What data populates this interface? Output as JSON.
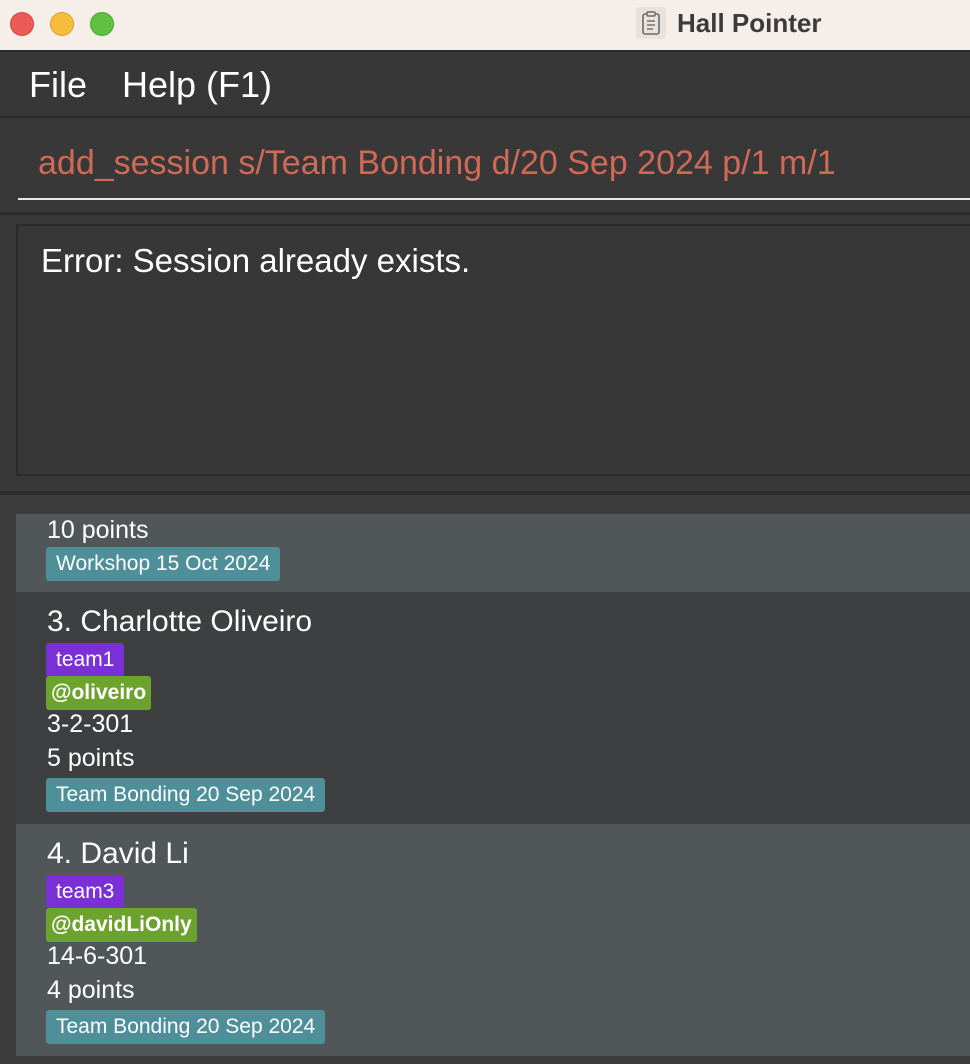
{
  "window": {
    "title": "Hall Pointer"
  },
  "menu": {
    "file": "File",
    "help": "Help (F1)"
  },
  "command": {
    "value": "add_session s/Team Bonding d/20 Sep 2024 p/1 m/1"
  },
  "result": {
    "message": "Error: Session already exists."
  },
  "members": [
    {
      "points": "10 points",
      "sessions": [
        "Workshop 15 Oct 2024"
      ]
    },
    {
      "name": "3. Charlotte Oliveiro",
      "tag": "team1",
      "telegram": "@oliveiro",
      "room": "3-2-301",
      "points": "5 points",
      "sessions": [
        "Team Bonding 20 Sep 2024"
      ]
    },
    {
      "name": "4. David Li",
      "tag": "team3",
      "telegram": "@davidLiOnly",
      "room": "14-6-301",
      "points": "4 points",
      "sessions": [
        "Team Bonding 20 Sep 2024"
      ]
    }
  ],
  "colors": {
    "command_text": "#d06a57",
    "team_tag": "#7b2fd6",
    "telegram_tag": "#6ca32c",
    "session_tag": "#4e8f9a"
  },
  "icons": {
    "app": "clipboard-icon"
  }
}
